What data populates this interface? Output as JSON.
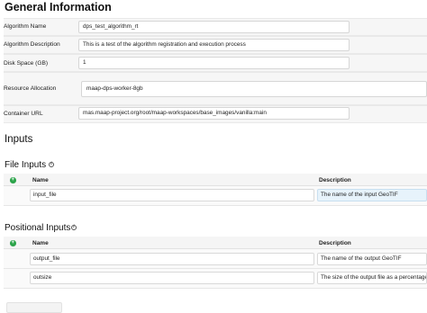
{
  "general": {
    "heading": "General Information",
    "fields": [
      {
        "label": "Algorithm Name",
        "value": "dps_test_algorithm_rt"
      },
      {
        "label": "Algorithm Description",
        "value": "This is a test of the algorithm registration and execution process"
      },
      {
        "label": "Disk Space (GB)",
        "value": "1"
      },
      {
        "label": "Resource Allocation",
        "value": "maap-dps-worker-8gb"
      },
      {
        "label": "Container URL",
        "value": "mas.maap-project.org/root/maap-workspaces/base_images/vanilla:main"
      }
    ]
  },
  "inputs": {
    "heading": "Inputs",
    "file_inputs": {
      "heading": "File Inputs",
      "columns": {
        "name": "Name",
        "description": "Description"
      },
      "rows": [
        {
          "name": "input_file",
          "description": "The name of the input GeoTIF"
        }
      ]
    },
    "positional_inputs": {
      "heading": "Positional Inputs",
      "columns": {
        "name": "Name",
        "description": "Description"
      },
      "rows": [
        {
          "name": "output_file",
          "description": "The name of the output GeoTIF"
        },
        {
          "name": "outsize",
          "description": "The size of the output file as a percentage"
        }
      ]
    }
  },
  "icons": {
    "info": "info-icon",
    "add": "add-icon"
  },
  "colors": {
    "add_green": "#2ca44a",
    "selected_bg": "#e7f3fb"
  }
}
